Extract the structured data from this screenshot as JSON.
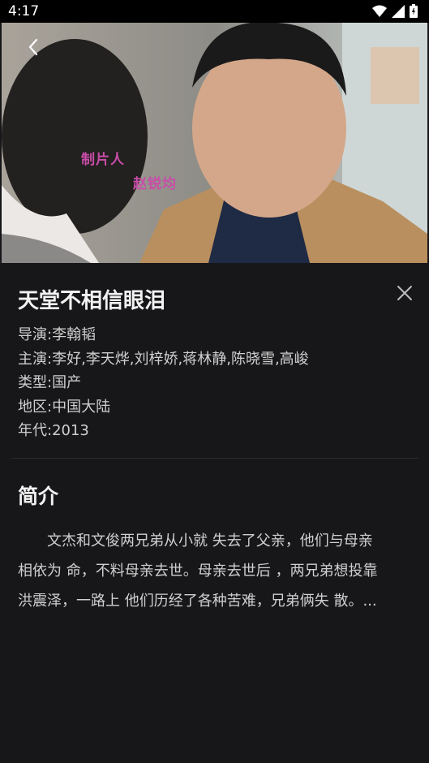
{
  "status_bar": {
    "time": "4:17"
  },
  "video": {
    "watermark_title": "制片人",
    "watermark_name": "赵锐均"
  },
  "detail": {
    "title": "天堂不相信眼泪",
    "info": [
      {
        "label": "导演:",
        "value": "李翰韬"
      },
      {
        "label": "主演:",
        "value": "李好,李天烨,刘梓娇,蒋林静,陈晓雪,高峻"
      },
      {
        "label": "类型:",
        "value": "国产"
      },
      {
        "label": "地区:",
        "value": "中国大陆"
      },
      {
        "label": "年代:",
        "value": "2013"
      }
    ]
  },
  "intro": {
    "heading": "简介",
    "lines": [
      "　　文杰和文俊两兄弟从小就 失去了父亲，他们与母亲",
      "相依为 命，不料母亲去世。母亲去世后 ，两兄弟想投靠",
      "洪震泽，一路上 他们历经了各种苦难，兄弟俩失 散。..."
    ]
  },
  "colors": {
    "background": "#17171a",
    "status_bar": "#000000",
    "text_primary": "#f2f2f2",
    "text_secondary": "#cfcfcf",
    "watermark": "#c94da8"
  },
  "icons": [
    "wifi-icon",
    "signal-icon",
    "battery-icon",
    "back-arrow-icon",
    "close-icon"
  ]
}
